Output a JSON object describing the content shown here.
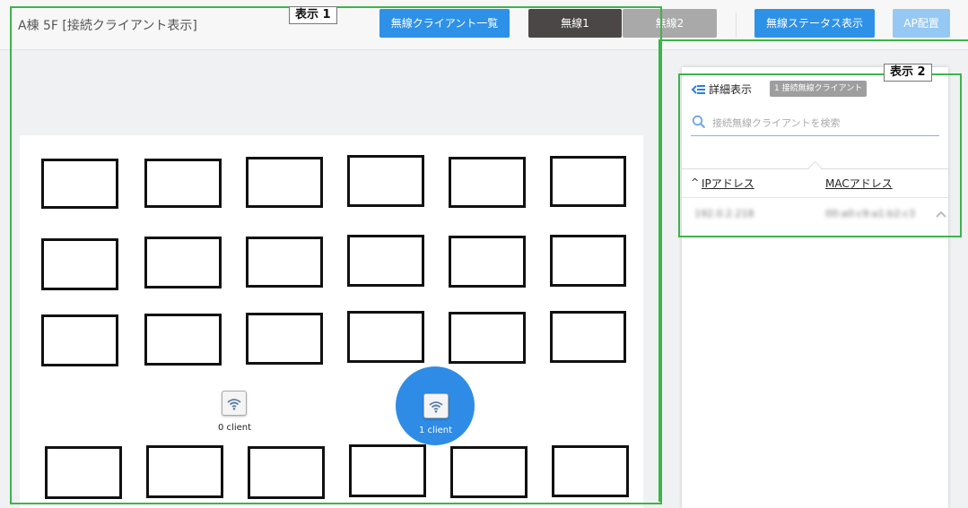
{
  "header": {
    "title": "A棟 5F [接続クライアント表示]",
    "client_list_button": "無線クライアント一覧",
    "wireless1_tab": "無線1",
    "wireless2_tab": "無線2",
    "wireless_status_button": "無線ステータス表示",
    "ap_placement_button": "AP配置"
  },
  "annotations": {
    "label1": "表示 1",
    "label2": "表示 2"
  },
  "floor_plan": {
    "access_points": [
      {
        "label": "0 client",
        "client_count": 0,
        "selected": false
      },
      {
        "label": "1 client",
        "client_count": 1,
        "selected": true
      }
    ]
  },
  "detail_panel": {
    "title": "詳細表示",
    "client_count_badge": "1 接続無線クライアント",
    "search_placeholder": "接続無線クライアントを検索",
    "columns": {
      "ip": "IPアドレス",
      "mac": "MACアドレス"
    },
    "sort_indicator": "^",
    "rows": [
      {
        "ip": "192.0.2.218",
        "mac": "00:a0:c9:a1:b2:c3"
      }
    ]
  },
  "colors": {
    "primary_blue": "#2e91e8",
    "dark_tab": "#4a4746",
    "gray_tab": "#a9a9a9",
    "light_blue_button": "#96c8f4",
    "annotation_green": "#3cb44b"
  }
}
